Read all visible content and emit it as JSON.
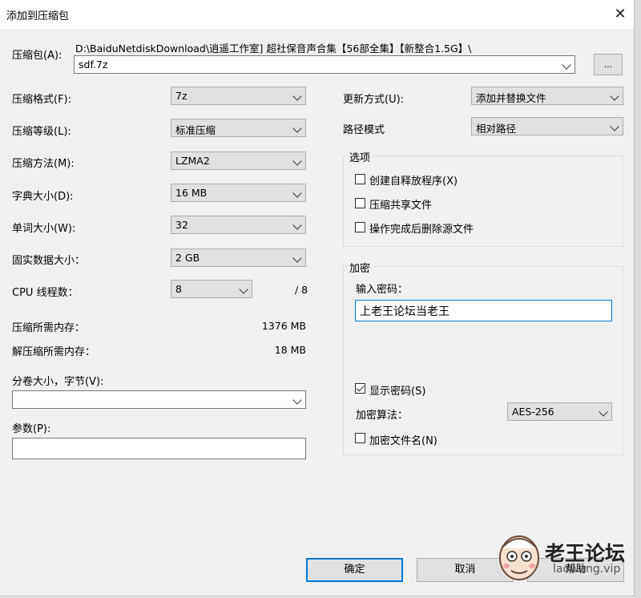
{
  "window": {
    "title": "添加到压缩包",
    "close_icon": "close-icon"
  },
  "archive": {
    "label": "压缩包(A):",
    "path": "D:\\BaiduNetdiskDownload\\逍遥工作室] 超社保音声合集【56部全集】【新整合1.5G】\\",
    "filename": "sdf.7z",
    "browse_label": "..."
  },
  "left": {
    "format": {
      "label": "压缩格式(F):",
      "value": "7z"
    },
    "level": {
      "label": "压缩等级(L):",
      "value": "标准压缩"
    },
    "method": {
      "label": "压缩方法(M):",
      "value": "LZMA2"
    },
    "dict": {
      "label": "字典大小(D):",
      "value": "16 MB"
    },
    "word": {
      "label": "单词大小(W):",
      "value": "32"
    },
    "solid": {
      "label": "固实数据大小：",
      "value": "2 GB"
    },
    "cpu": {
      "label": "CPU 线程数：",
      "value": "8",
      "total": "/ 8"
    },
    "mem_compress": {
      "label": "压缩所需内存：",
      "value": "1376 MB"
    },
    "mem_decompress": {
      "label": "解压缩所需内存：",
      "value": "18 MB"
    },
    "volume": {
      "label": "分卷大小，字节(V):",
      "value": ""
    },
    "params": {
      "label": "参数(P):",
      "value": ""
    }
  },
  "right": {
    "update": {
      "label": "更新方式(U):",
      "value": "添加并替换文件"
    },
    "pathmode": {
      "label": "路径模式",
      "value": "相对路径"
    },
    "options": {
      "title": "选项",
      "sfx": {
        "label": "创建自释放程序(X)",
        "checked": false
      },
      "shared": {
        "label": "压缩共享文件",
        "checked": false
      },
      "delete": {
        "label": "操作完成后删除源文件",
        "checked": false
      }
    },
    "encryption": {
      "title": "加密",
      "password_label": "输入密码：",
      "password_value": "上老王论坛当老王",
      "show_password": {
        "label": "显示密码(S)",
        "checked": true
      },
      "algo": {
        "label": "加密算法：",
        "value": "AES-256"
      },
      "encrypt_names": {
        "label": "加密文件名(N)",
        "checked": false
      }
    }
  },
  "buttons": {
    "ok": "确定",
    "cancel": "取消",
    "help": "帮助"
  },
  "watermark": {
    "brand": "老王论坛",
    "url": "laowang.vip"
  }
}
